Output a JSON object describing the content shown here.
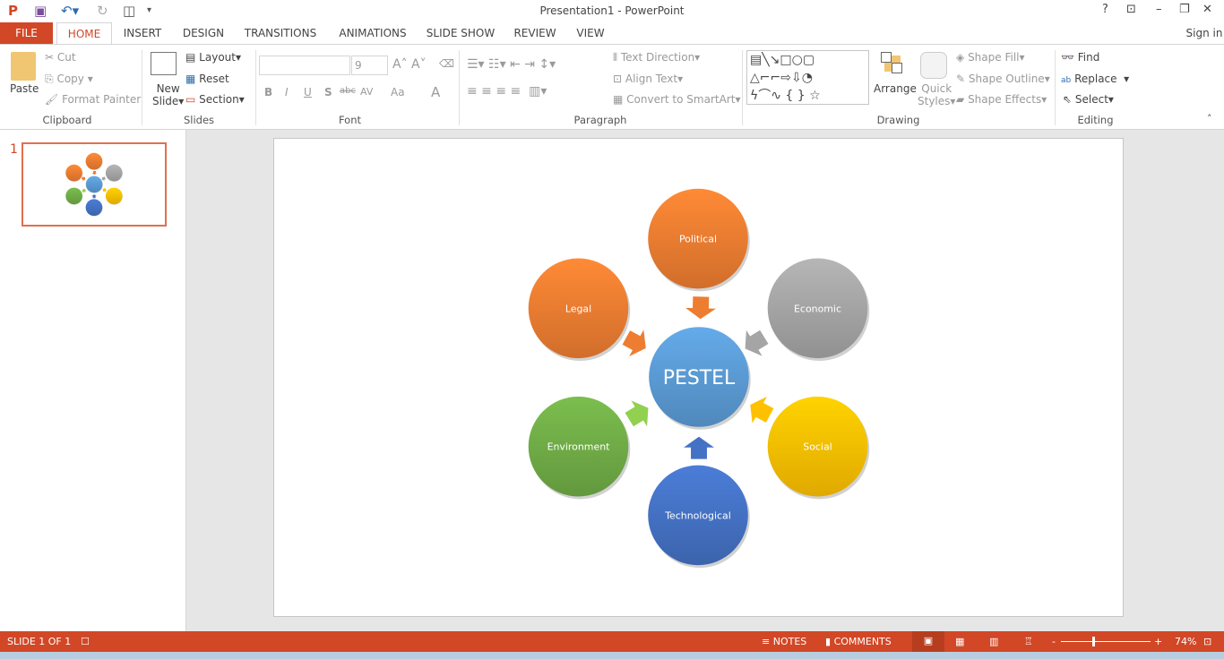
{
  "window": {
    "title": "Presentation1 - PowerPoint",
    "help": "?",
    "sign_in": "Sign in"
  },
  "tabs": [
    "FILE",
    "HOME",
    "INSERT",
    "DESIGN",
    "TRANSITIONS",
    "ANIMATIONS",
    "SLIDE SHOW",
    "REVIEW",
    "VIEW"
  ],
  "ribbon": {
    "clipboard": {
      "paste": "Paste",
      "cut": "Cut",
      "copy": "Copy",
      "format_painter": "Format Painter",
      "label": "Clipboard"
    },
    "slides": {
      "new_slide_1": "New",
      "new_slide_2": "Slide",
      "layout": "Layout",
      "reset": "Reset",
      "section": "Section",
      "label": "Slides"
    },
    "font": {
      "font_name": "",
      "font_size": "9",
      "bold": "B",
      "italic": "I",
      "underline": "U",
      "shadow": "S",
      "strike": "abc",
      "spacing": "AV",
      "case": "Aa",
      "color": "A",
      "label": "Font"
    },
    "paragraph": {
      "text_direction": "Text Direction",
      "align_text": "Align Text",
      "smartart": "Convert to SmartArt",
      "label": "Paragraph"
    },
    "drawing": {
      "arrange": "Arrange",
      "quick_styles_1": "Quick",
      "quick_styles_2": "Styles",
      "shape_fill": "Shape Fill",
      "shape_outline": "Shape Outline",
      "shape_effects": "Shape Effects",
      "label": "Drawing"
    },
    "editing": {
      "find": "Find",
      "replace": "Replace",
      "select": "Select",
      "label": "Editing"
    }
  },
  "thumbnail": {
    "number": "1"
  },
  "diagram": {
    "center": {
      "label": "PESTEL",
      "color": "#5b9bd5"
    },
    "nodes": [
      {
        "label": "Political",
        "color": "#ed7d31"
      },
      {
        "label": "Economic",
        "color": "#a5a5a5"
      },
      {
        "label": "Social",
        "color": "#ffc000"
      },
      {
        "label": "Technological",
        "color": "#4472c4"
      },
      {
        "label": "Environment",
        "color": "#70ad47"
      },
      {
        "label": "Legal",
        "color": "#ed7d31"
      }
    ],
    "arrow_colors": [
      "#ed7d31",
      "#a5a5a5",
      "#ffc000",
      "#4472c4",
      "#92d050",
      "#ed7d31"
    ]
  },
  "status": {
    "slide": "SLIDE 1 OF 1",
    "notes": "NOTES",
    "comments": "COMMENTS",
    "zoom": "74%"
  }
}
